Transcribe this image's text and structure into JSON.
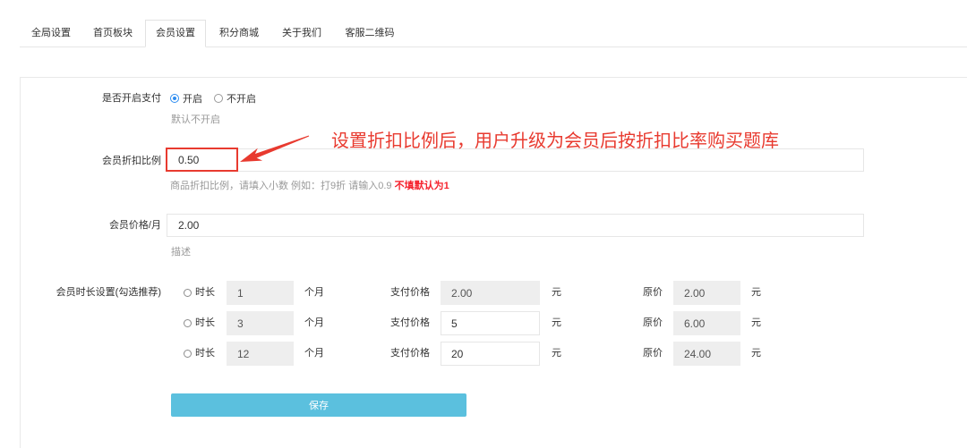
{
  "tabs": [
    {
      "label": "全局设置",
      "active": false
    },
    {
      "label": "首页板块",
      "active": false
    },
    {
      "label": "会员设置",
      "active": true
    },
    {
      "label": "积分商城",
      "active": false
    },
    {
      "label": "关于我们",
      "active": false
    },
    {
      "label": "客服二维码",
      "active": false
    }
  ],
  "form": {
    "pay_enable": {
      "label": "是否开启支付",
      "options": [
        {
          "label": "开启",
          "checked": true
        },
        {
          "label": "不开启",
          "checked": false
        }
      ],
      "help": "默认不开启"
    },
    "discount": {
      "label": "会员折扣比例",
      "value": "0.50",
      "help": "商品折扣比例，请填入小数 例如：打9折 请输入0.9",
      "help_highlight": "不填默认为1"
    },
    "monthly_price": {
      "label": "会员价格/月",
      "value": "2.00",
      "help": "描述"
    },
    "durations": {
      "label": "会员时长设置(勾选推荐)",
      "duration_label": "时长",
      "unit_label": "个月",
      "pay_label": "支付价格",
      "currency_label": "元",
      "original_label": "原价",
      "rows": [
        {
          "checked": false,
          "months": "1",
          "pay_price": "2.00",
          "original_price": "2.00",
          "pay_editable": false
        },
        {
          "checked": false,
          "months": "3",
          "pay_price": "5",
          "original_price": "6.00",
          "pay_editable": true
        },
        {
          "checked": false,
          "months": "12",
          "pay_price": "20",
          "original_price": "24.00",
          "pay_editable": true
        }
      ]
    }
  },
  "save_label": "保存",
  "annotation": {
    "text": "设置折扣比例后，用户升级为会员后按折扣比率购买题库"
  },
  "colors": {
    "accent": "#2d8cf0",
    "button": "#5bc0de",
    "annotation": "#e83a2f",
    "help_highlight": "#f5222d",
    "readonly_input": "#eeeeee"
  }
}
